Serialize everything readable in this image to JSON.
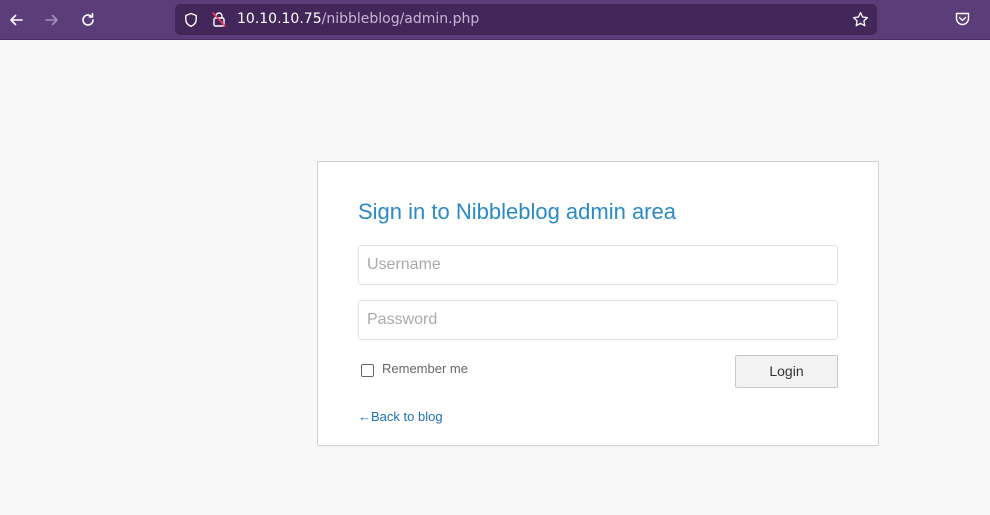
{
  "browser": {
    "url_host": "10.10.10.75",
    "url_path": "/nibbleblog/admin.php",
    "icons": {
      "back": "back-arrow-icon",
      "forward": "forward-arrow-icon",
      "reload": "reload-icon",
      "shield": "shield-icon",
      "lock": "insecure-lock-icon",
      "bookmark": "star-icon",
      "pocket": "pocket-icon"
    },
    "colors": {
      "toolbar": "#5b3d79",
      "urlbar": "#43275b"
    }
  },
  "login": {
    "title": "Sign in to Nibbleblog admin area",
    "username_placeholder": "Username",
    "username_value": "",
    "password_placeholder": "Password",
    "password_value": "",
    "remember_label": "Remember me",
    "remember_checked": false,
    "login_button": "Login",
    "back_link": "←Back to blog",
    "colors": {
      "title": "#2a8ac6",
      "link": "#1f6fb5"
    }
  }
}
